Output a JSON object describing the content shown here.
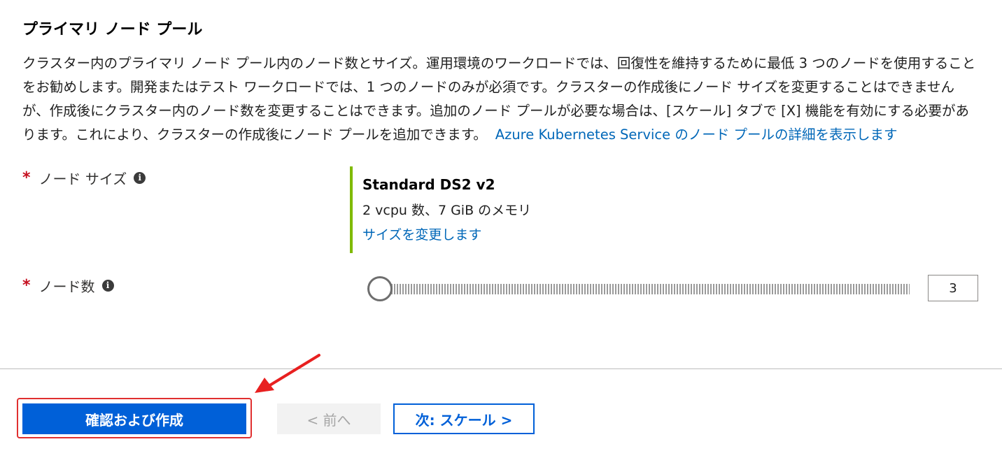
{
  "section": {
    "title": "プライマリ ノード プール",
    "description": "クラスター内のプライマリ ノード プール内のノード数とサイズ。運用環境のワークロードでは、回復性を維持するために最低 3 つのノードを使用することをお勧めします。開発またはテスト ワークロードでは、1 つのノードのみが必須です。クラスターの作成後にノード サイズを変更することはできませんが、作成後にクラスター内のノード数を変更することはできます。追加のノード プールが必要な場合は、[スケール] タブで [X] 機能を有効にする必要があります。これにより、クラスターの作成後にノード プールを追加できます。",
    "link_text": "Azure Kubernetes Service のノード プールの詳細を表示します"
  },
  "node_size": {
    "required_mark": "*",
    "label": "ノード サイズ",
    "info_glyph": "i",
    "size_name": "Standard DS2 v2",
    "size_spec": "2 vcpu 数、7 GiB のメモリ",
    "change_link": "サイズを変更します"
  },
  "node_count": {
    "required_mark": "*",
    "label": "ノード数",
    "info_glyph": "i",
    "value": "3",
    "slider_fraction": 0
  },
  "footer": {
    "review_create_label": "確認および作成",
    "prev_label": "< 前へ",
    "next_label": "次: スケール >"
  },
  "colors": {
    "primary": "#0060d8",
    "link": "#0067b8",
    "accent_border": "#7fba00",
    "required": "#c50f1f",
    "highlight": "#e03030"
  },
  "icons": {
    "info": "info-icon",
    "annotation_arrow": "red-arrow-icon"
  }
}
